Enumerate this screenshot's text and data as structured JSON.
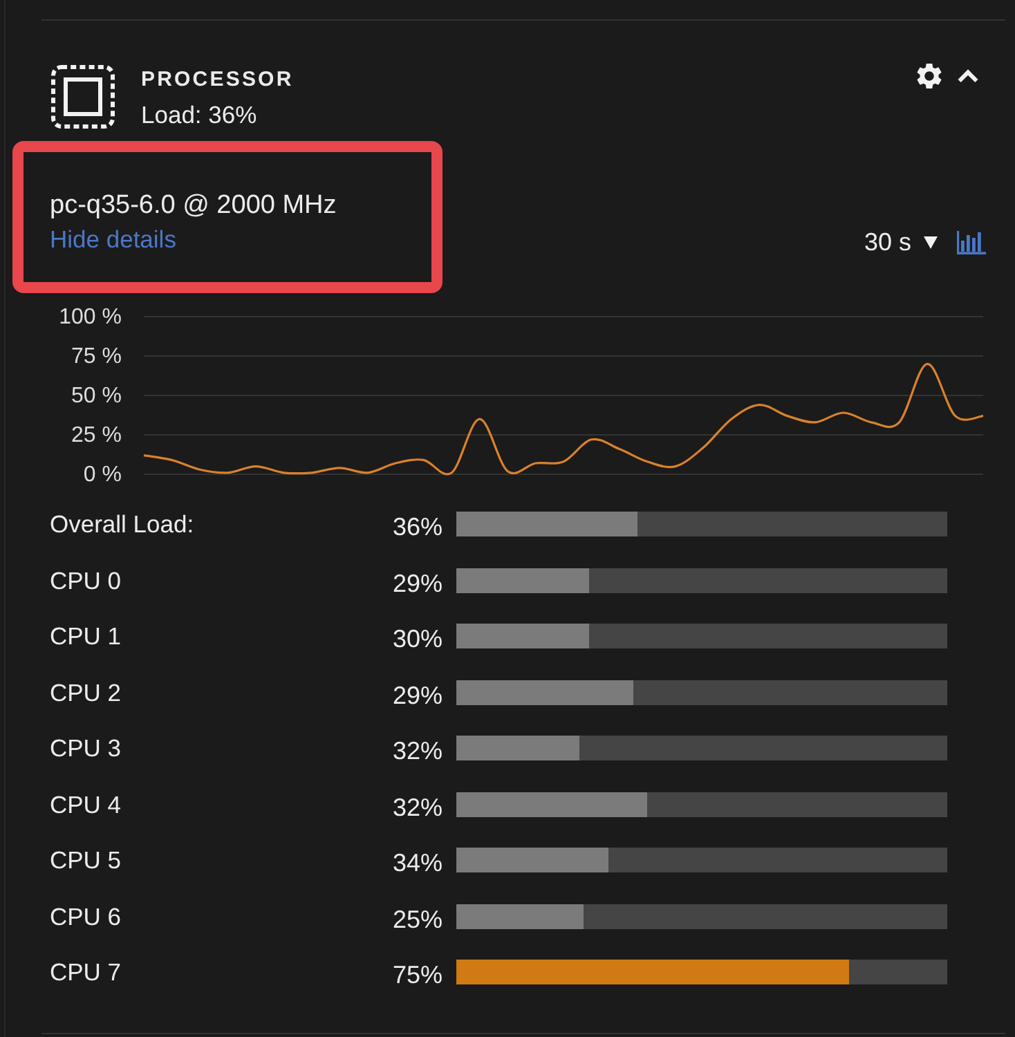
{
  "panel": {
    "title": "PROCESSOR",
    "subtitle": "Load: 36%",
    "expanded": true
  },
  "details": {
    "model": "pc-q35-6.0 @ 2000 MHz",
    "toggle": "Hide details",
    "highlighted": true
  },
  "time_range": {
    "value": "30 s"
  },
  "chart": {
    "chart_data": {
      "type": "line",
      "grid": true,
      "ylim": [
        0,
        100
      ],
      "yticks": [
        {
          "value": 100,
          "label": "100 %"
        },
        {
          "value": 75,
          "label": "75 %"
        },
        {
          "value": 50,
          "label": "50 %"
        },
        {
          "value": 25,
          "label": "25 %"
        },
        {
          "value": 0,
          "label": "0 %"
        }
      ],
      "series": [
        {
          "color": "#d9822b",
          "values": [
            12,
            9,
            3,
            1,
            5,
            1,
            1,
            4,
            1,
            7,
            9,
            1,
            35,
            2,
            7,
            8,
            22,
            16,
            8,
            5,
            17,
            35,
            44,
            37,
            33,
            39,
            33,
            33,
            70,
            37,
            37
          ]
        }
      ]
    }
  },
  "bars": [
    {
      "label": "Overall Load:",
      "reading": "36%",
      "level": 0.37,
      "color": "#7b7b7b"
    },
    {
      "label": "CPU 0",
      "reading": "29%",
      "level": 0.27,
      "color": "#7b7b7b"
    },
    {
      "label": "CPU 1",
      "reading": "30%",
      "level": 0.27,
      "color": "#7b7b7b"
    },
    {
      "label": "CPU 2",
      "reading": "29%",
      "level": 0.36,
      "color": "#7b7b7b"
    },
    {
      "label": "CPU 3",
      "reading": "32%",
      "level": 0.25,
      "color": "#7b7b7b"
    },
    {
      "label": "CPU 4",
      "reading": "32%",
      "level": 0.39,
      "color": "#7b7b7b"
    },
    {
      "label": "CPU 5",
      "reading": "34%",
      "level": 0.31,
      "color": "#7b7b7b"
    },
    {
      "label": "CPU 6",
      "reading": "25%",
      "level": 0.26,
      "color": "#7b7b7b"
    },
    {
      "label": "CPU 7",
      "reading": "75%",
      "level": 0.8,
      "color": "#cf7a12"
    }
  ]
}
